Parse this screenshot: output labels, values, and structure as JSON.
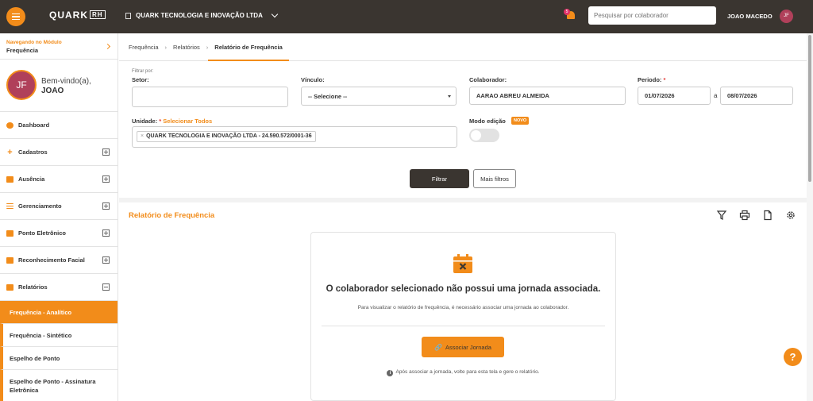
{
  "topbar": {
    "logo": "QUARK",
    "logo_suffix": "RH",
    "company": "QUARK TECNOLOGIA E INOVAÇÃO LTDA",
    "notification_count": "5",
    "search_placeholder": "Pesquisar por colaborador",
    "user_name": "JOAO MACEDO",
    "user_initials": "JF"
  },
  "sidebar": {
    "module_label": "Navegando no Módulo",
    "module_value": "Frequência",
    "welcome": "Bem-vindo(a),",
    "user_first": "JOAO",
    "user_initials": "JF",
    "items": [
      {
        "label": "Dashboard"
      },
      {
        "label": "Cadastros"
      },
      {
        "label": "Ausência"
      },
      {
        "label": "Gerenciamento"
      },
      {
        "label": "Ponto Eletrônico"
      },
      {
        "label": "Reconhecimento Facial"
      },
      {
        "label": "Relatórios"
      }
    ],
    "sub_items": [
      {
        "label": "Frequência - Analítico"
      },
      {
        "label": "Frequência - Sintético"
      },
      {
        "label": "Espelho de Ponto"
      },
      {
        "label": "Espelho de Ponto - Assinatura Eletrônica"
      }
    ]
  },
  "breadcrumb": {
    "items": [
      "Frequência",
      "Relatórios",
      "Relatório de Frequência"
    ]
  },
  "filters": {
    "filter_by": "Filtrar por:",
    "setor_label": "Setor:",
    "vinculo_label": "Vínculo:",
    "vinculo_value": "-- Selecione --",
    "colaborador_label": "Colaborador:",
    "colaborador_value": "AARAO ABREU ALMEIDA",
    "periodo_label": "Periodo:",
    "periodo_req": "*",
    "date_from": "01/07/2026",
    "date_sep": "a",
    "date_to": "08/07/2026",
    "unidade_label": "Unidade:",
    "unidade_req": "*",
    "select_all": "Selecionar Todos",
    "unidade_chip_x": "×",
    "unidade_chip": "QUARK TECNOLOGIA E INOVAÇÃO LTDA - 24.590.572/0001-36",
    "modo_label": "Modo edição",
    "novo_badge": "NOVO",
    "modo_on": false,
    "btn_filtrar": "Filtrar",
    "btn_mais": "Mais filtros"
  },
  "report": {
    "title": "Relatório de Frequência",
    "message": "O colaborador selecionado não possui uma jornada associada.",
    "sub_message": "Para visualizar o relatório de frequência, é necessário associar uma jornada ao colaborador.",
    "btn_associar": "Associar Jornada",
    "note": "Após associar a jornada, volte para esta tela e gere o relatório."
  },
  "help_label": "?",
  "colors": {
    "accent": "#f28c1a",
    "dark": "#3a3530",
    "avatar": "#b0405a"
  }
}
